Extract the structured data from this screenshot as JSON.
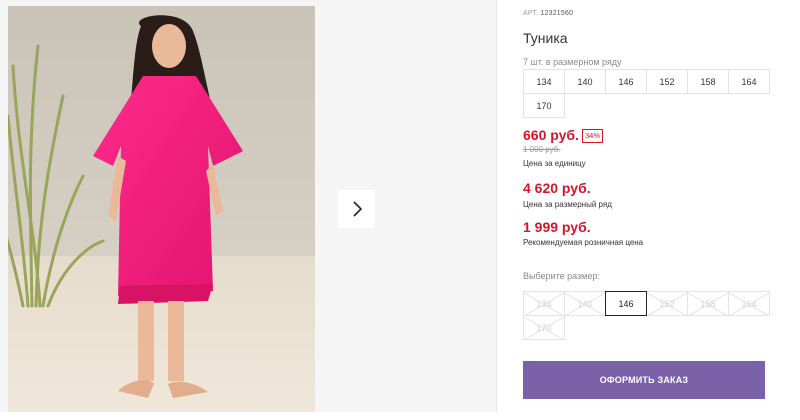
{
  "product": {
    "article_label": "АРТ.",
    "article": "12321560",
    "title": "Туника",
    "sizes_note": "7 шт. в размерном ряду",
    "size_row": [
      "134",
      "140",
      "146",
      "152",
      "158",
      "164",
      "170"
    ]
  },
  "prices": {
    "unit_price": "660 руб.",
    "discount": "34%",
    "old_price": "1 000 руб.",
    "unit_label": "Цена за единицу",
    "row_price": "4 620 руб.",
    "row_label": "Цена за размерный ряд",
    "rrp_price": "1 999 руб.",
    "rrp_label": "Рекомендуемая розничная цена",
    "accent_color": "#d4152b"
  },
  "size_picker": {
    "label": "Выберите размер:",
    "options": [
      {
        "label": "134",
        "state": "disabled"
      },
      {
        "label": "140",
        "state": "disabled"
      },
      {
        "label": "146",
        "state": "selected"
      },
      {
        "label": "152",
        "state": "disabled"
      },
      {
        "label": "158",
        "state": "disabled"
      },
      {
        "label": "164",
        "state": "disabled"
      },
      {
        "label": "170",
        "state": "disabled"
      }
    ]
  },
  "order_button": {
    "label": "ОФОРМИТЬ ЗАКАЗ",
    "color": "#7b62a8"
  },
  "gallery": {
    "next_icon": "chevron-right-icon"
  }
}
